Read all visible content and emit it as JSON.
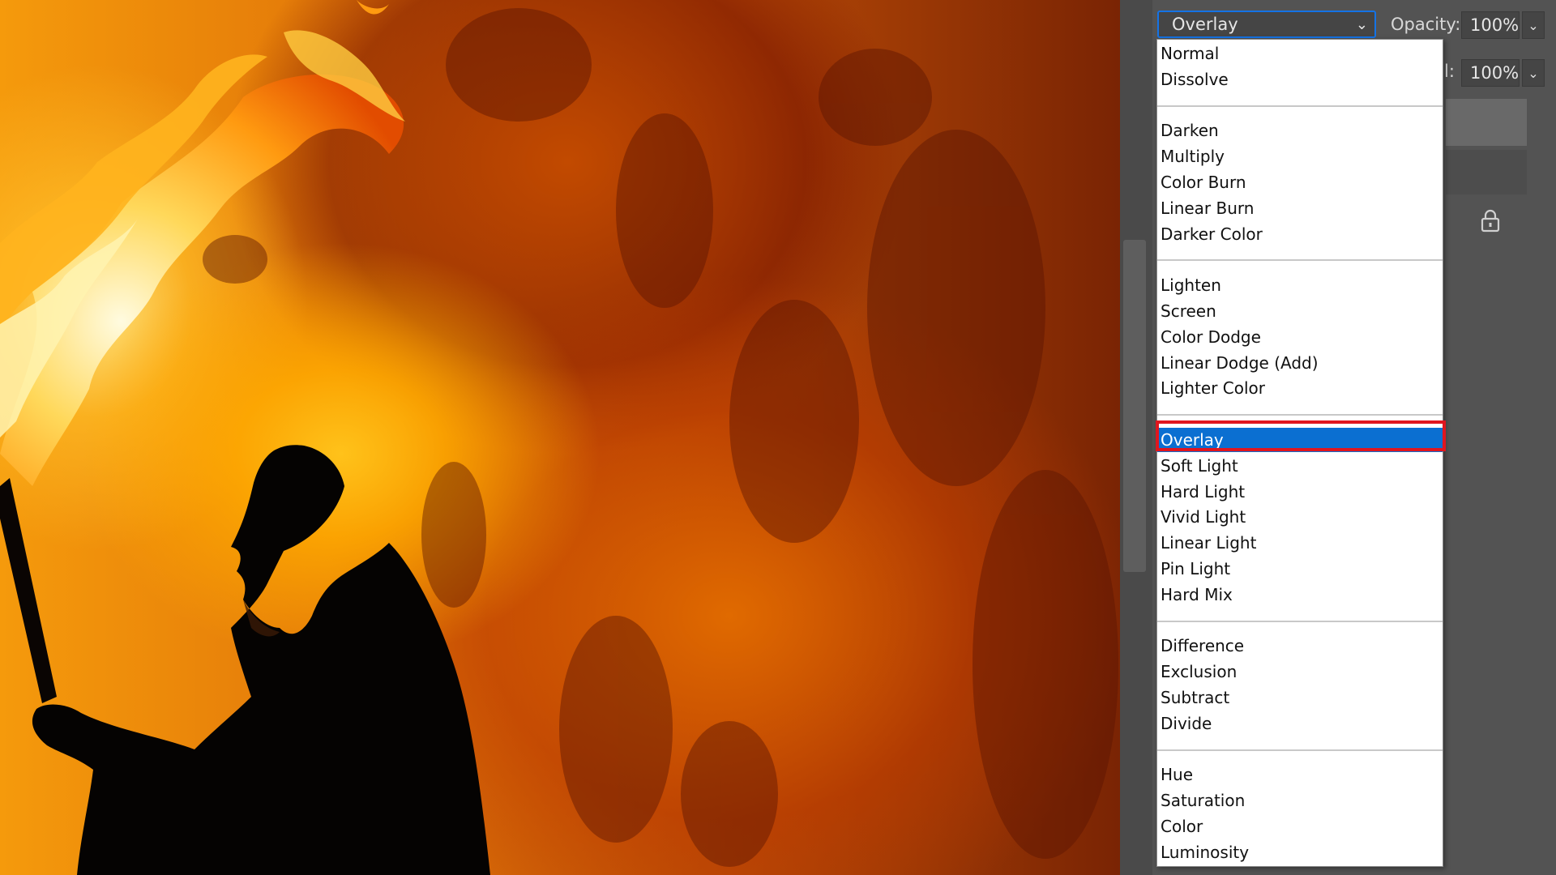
{
  "blend_mode": {
    "selected": "Overlay",
    "chevron_icon": "chevron-down-icon"
  },
  "opacity": {
    "label": "Opacity:",
    "value": "100%"
  },
  "fill": {
    "label_partial": "l:",
    "value": "100%"
  },
  "menu_groups": [
    [
      "Normal",
      "Dissolve"
    ],
    [
      "Darken",
      "Multiply",
      "Color Burn",
      "Linear Burn",
      "Darker Color"
    ],
    [
      "Lighten",
      "Screen",
      "Color Dodge",
      "Linear Dodge (Add)",
      "Lighter Color"
    ],
    [
      "Overlay",
      "Soft Light",
      "Hard Light",
      "Vivid Light",
      "Linear Light",
      "Pin Light",
      "Hard Mix"
    ],
    [
      "Difference",
      "Exclusion",
      "Subtract",
      "Divide"
    ],
    [
      "Hue",
      "Saturation",
      "Color",
      "Luminosity"
    ]
  ],
  "colors": {
    "selection": "#0b6fd1",
    "annotation": "#e0161f",
    "focus_border": "#1473e6",
    "panel": "#535353"
  },
  "icons": {
    "lock": "lock-icon"
  }
}
